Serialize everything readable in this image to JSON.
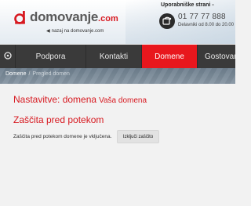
{
  "header": {
    "logo_text": "domovanje",
    "logo_tld": ".com",
    "back_link": "nazaj na domovanje.com",
    "user_pages": "Uporabniške strani -",
    "phone": "01 77 77 888",
    "hours": "Delavniki od 8.00 do 20.00",
    "logo_color": "#d71920"
  },
  "nav": {
    "home_icon": "home-icon",
    "items": [
      {
        "label": "Podpora"
      },
      {
        "label": "Kontakti"
      },
      {
        "label": "Domene",
        "active": true
      },
      {
        "label": "Gostovar"
      }
    ],
    "active_color": "#e8171d"
  },
  "breadcrumb": {
    "items": [
      "Domene",
      "Pregled domen"
    ],
    "separator": "/"
  },
  "main": {
    "title_label": "Nastavitve: domena",
    "title_domain": "Vaša domena",
    "section_title": "Zaščita pred potekom",
    "protection_text": "Zaščita pred potekom domene je vključena.",
    "disable_button": "Izključi zaščito"
  }
}
